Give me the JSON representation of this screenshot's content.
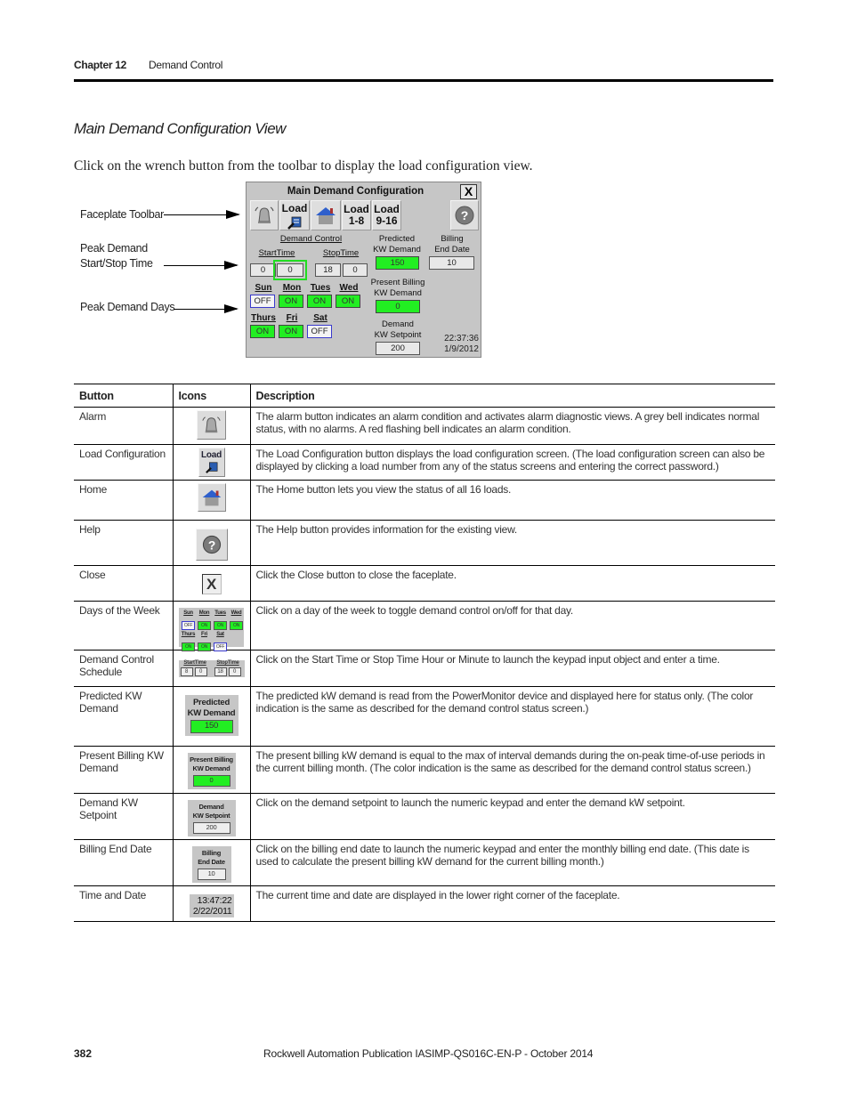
{
  "header": {
    "chapter": "Chapter 12",
    "title": "Demand Control"
  },
  "section_title": "Main Demand Configuration View",
  "intro": "Click on the wrench button from the toolbar to display the load configuration view.",
  "callouts": {
    "toolbar": "Faceplate Toolbar",
    "start_stop_line1": "Peak Demand",
    "start_stop_line2": "Start/Stop Time",
    "days": "Peak Demand Days"
  },
  "faceplate": {
    "title": "Main Demand Configuration",
    "close_label": "X",
    "toolbar": {
      "load_label": "Load",
      "load_1_8_line1": "Load",
      "load_1_8_line2": "1-8",
      "load_9_16_line1": "Load",
      "load_9_16_line2": "9-16",
      "help_glyph": "?"
    },
    "demand_control_label": "Demand Control",
    "start_time_label": "StartTime",
    "stop_time_label": "StopTime",
    "start_hour": "0",
    "start_minute": "0",
    "stop_hour": "18",
    "stop_minute": "0",
    "predicted_line1": "Predicted",
    "predicted_line2": "KW Demand",
    "predicted_value": "150",
    "billing_line1": "Billing",
    "billing_line2": "End Date",
    "billing_value": "10",
    "present_line1": "Present Billing",
    "present_line2": "KW Demand",
    "present_value": "0",
    "setpoint_line1": "Demand",
    "setpoint_line2": "KW Setpoint",
    "setpoint_value": "200",
    "days": [
      {
        "label": "Sun",
        "state": "OFF"
      },
      {
        "label": "Mon",
        "state": "ON"
      },
      {
        "label": "Tues",
        "state": "ON"
      },
      {
        "label": "Wed",
        "state": "ON"
      },
      {
        "label": "Thurs",
        "state": "ON"
      },
      {
        "label": "Fri",
        "state": "ON"
      },
      {
        "label": "Sat",
        "state": "OFF"
      }
    ],
    "time": "22:37:36",
    "date": "1/9/2012"
  },
  "table": {
    "headers": [
      "Button",
      "Icons",
      "Description"
    ],
    "rows": [
      {
        "button": "Alarm",
        "icon": "bell-icon",
        "description": "The alarm button indicates an alarm condition and activates alarm diagnostic views. A grey bell indicates normal status, with no alarms. A red flashing bell indicates an alarm condition."
      },
      {
        "button": "Load Configuration",
        "icon": "load-wrench-icon",
        "icon_label": "Load",
        "description": "The Load Configuration button displays the load configuration screen. (The load configuration screen can also be displayed by clicking a load number from any of the status screens and entering the correct password.)"
      },
      {
        "button": "Home",
        "icon": "home-icon",
        "description": "The Home button lets you view the status of all 16 loads."
      },
      {
        "button": "Help",
        "icon": "help-icon",
        "icon_label": "?",
        "description": "The Help button provides information for the existing view."
      },
      {
        "button": "Close",
        "icon": "close-icon",
        "icon_label": "X",
        "description": "Click the Close button to close the faceplate."
      },
      {
        "button": "Days of the Week",
        "icon": "days-thumbnail",
        "description": "Click on a day of the week to toggle demand control on/off for that day."
      },
      {
        "button": "Demand Control Schedule",
        "icon": "schedule-thumbnail",
        "thumb": {
          "start_label": "StartTime",
          "stop_label": "StopTime",
          "values": [
            "8",
            "0",
            "18",
            "0"
          ]
        },
        "description": "Click on the Start Time or Stop Time Hour or Minute to launch the keypad input object and enter a time."
      },
      {
        "button": "Predicted KW Demand",
        "icon": "predicted-thumbnail",
        "thumb": {
          "line1": "Predicted",
          "line2": "KW Demand",
          "value": "150"
        },
        "description": "The predicted kW demand is read from the PowerMonitor device and displayed here for status only. (The color indication is the same as described for the demand control status screen.)"
      },
      {
        "button": "Present Billing KW Demand",
        "icon": "present-billing-thumbnail",
        "thumb": {
          "line1": "Present Billing",
          "line2": "KW Demand",
          "value": "0"
        },
        "description": "The present billing kW demand is equal to the max of interval demands during the on-peak time-of-use periods in the current billing month. (The color indication is the same as described for the demand control status screen.)"
      },
      {
        "button": "Demand KW Setpoint",
        "icon": "setpoint-thumbnail",
        "thumb": {
          "line1": "Demand",
          "line2": "KW Setpoint",
          "value": "200"
        },
        "description": "Click on the demand setpoint to launch the numeric keypad and enter the demand kW setpoint."
      },
      {
        "button": "Billing End Date",
        "icon": "billing-end-thumbnail",
        "thumb": {
          "line1": "Billing",
          "line2": "End Date",
          "value": "10"
        },
        "description": "Click on the billing end date to launch the numeric keypad and enter the monthly billing end date. (This date is used to calculate the present billing kW demand for the current billing month.)"
      },
      {
        "button": "Time and Date",
        "icon": "time-date-thumbnail",
        "thumb": {
          "time": "13:47:22",
          "date": "2/22/2011"
        },
        "description": "The current time and date are displayed in the lower right corner of the faceplate."
      }
    ]
  },
  "footer": {
    "page_number": "382",
    "publication": "Rockwell Automation Publication IASIMP-QS016C-EN-P - October 2014"
  },
  "colors": {
    "on_green": "#22ee22",
    "panel_grey": "#c6c6c6",
    "off_border": "#3a3acc"
  }
}
